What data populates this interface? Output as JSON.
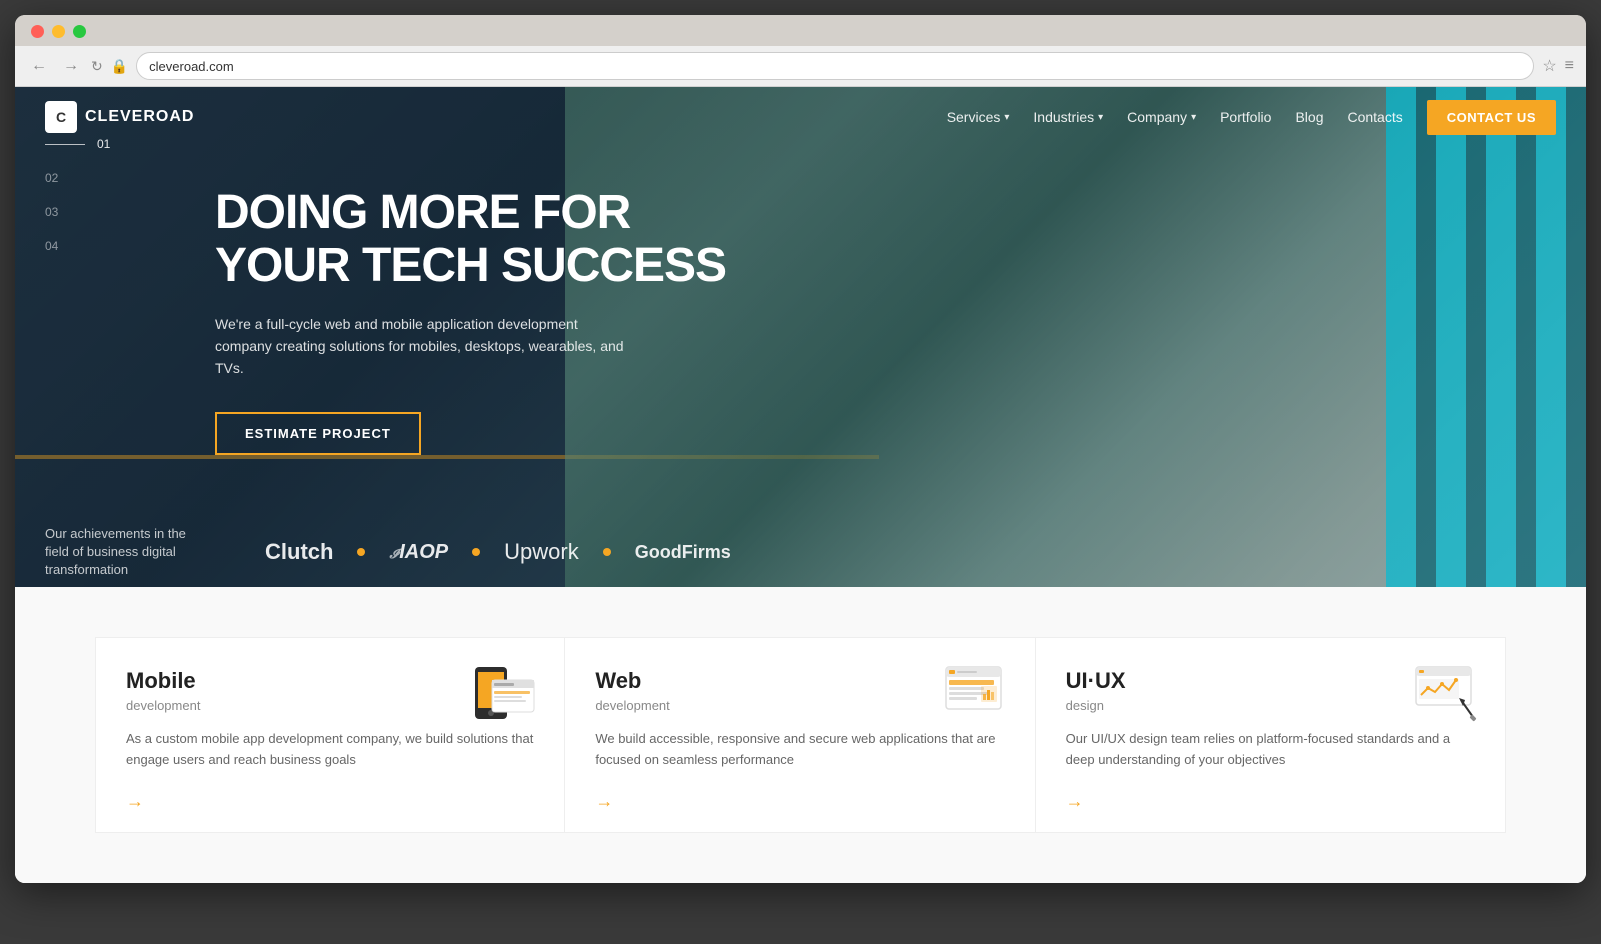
{
  "browser": {
    "url": "cleveroad.com"
  },
  "navbar": {
    "logo_text": "CLEVEROAD",
    "nav_items": [
      {
        "label": "Services",
        "has_dropdown": true
      },
      {
        "label": "Industries",
        "has_dropdown": true
      },
      {
        "label": "Company",
        "has_dropdown": true
      },
      {
        "label": "Portfolio",
        "has_dropdown": false
      },
      {
        "label": "Blog",
        "has_dropdown": false
      },
      {
        "label": "Contacts",
        "has_dropdown": false
      }
    ],
    "cta_button": "CONTACT US"
  },
  "hero": {
    "slide_numbers": [
      "01",
      "02",
      "03",
      "04"
    ],
    "active_slide": "01",
    "title": "DOING MORE FOR YOUR TECH SUCCESS",
    "subtitle": "We're a full-cycle web and mobile application development company creating solutions for mobiles, desktops, wearables, and TVs.",
    "cta_button": "ESTIMATE PROJECT",
    "achievements_text": "Our achievements in the field of business digital transformation",
    "partners": [
      "Clutch",
      "IAOP",
      "Upwork",
      "GoodFirms"
    ]
  },
  "services": [
    {
      "title": "Mobile",
      "subtitle": "development",
      "description": "As a custom mobile app development company, we build solutions that engage users and reach business goals"
    },
    {
      "title": "Web",
      "subtitle": "development",
      "description": "We build accessible, responsive and secure web applications that are focused on seamless performance"
    },
    {
      "title": "UI·UX",
      "subtitle": "design",
      "description": "Our UI/UX design team relies on platform-focused standards and a deep understanding of your objectives"
    }
  ]
}
